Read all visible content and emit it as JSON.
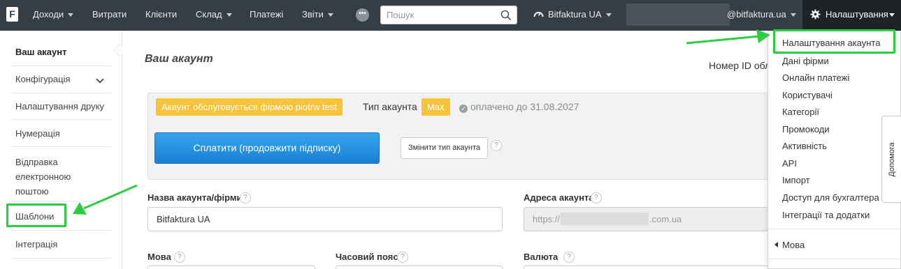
{
  "topbar": {
    "logo": "F",
    "nav": [
      {
        "label": "Доходи",
        "has_caret": true
      },
      {
        "label": "Витрати",
        "has_caret": false
      },
      {
        "label": "Клієнти",
        "has_caret": false
      },
      {
        "label": "Склад",
        "has_caret": true
      },
      {
        "label": "Платежі",
        "has_caret": false
      },
      {
        "label": "Звіти",
        "has_caret": true
      }
    ],
    "more_label": "•••",
    "search_placeholder": "Пошук",
    "company": "Bitfaktura UA",
    "email_suffix": "@bitfaktura.ua",
    "settings_label": "Налаштування"
  },
  "sidebar": {
    "items": [
      {
        "label": "Ваш акаунт",
        "active": true
      },
      {
        "label": "Конфігурація",
        "has_chevron": true
      },
      {
        "label": "Налаштування друку"
      },
      {
        "label": "Нумерація"
      },
      {
        "label": "Відправка електронною поштою"
      },
      {
        "label": "Шаблони"
      },
      {
        "label": "Інтеграція"
      }
    ]
  },
  "main": {
    "title": "Ваш акаунт",
    "id_label": "Номер ID облікового запису",
    "status": {
      "served_by": "Акаунт обслуговується фірмою piotrw test",
      "type_label": "Тип акаунта",
      "type_value": "Max",
      "paid_until": "оплачено до 31.08.2027"
    },
    "pay_button": "Сплатити (продовжити підписку)",
    "change_type_button": "Змінити тип акаунта",
    "help_q": "?",
    "fields": {
      "name_label": "Назва акаунта/фірми",
      "name_value": "Bitfaktura UA",
      "address_label": "Адреса акаунта",
      "address_prefix": "https://",
      "address_suffix": ".com.ua",
      "language_label": "Мова",
      "timezone_label": "Часовий пояс",
      "currency_label": "Валюта"
    }
  },
  "dropdown": {
    "items": [
      "Налаштування акаунта",
      "Дані фірми",
      "Онлайн платежі",
      "Користувачі",
      "Категорії",
      "Промокоди",
      "Активність",
      "API",
      "Імпорт",
      "Доступ для бухгалтера",
      "Інтеграції та додатки"
    ],
    "language": "Мова"
  },
  "help_tab": "Допомога",
  "colors": {
    "topbar": "#353d45",
    "settings_active": "#1e2328",
    "badge": "#f7c33b",
    "pay_button": "#1a7fd4",
    "annotation": "#2ecc40"
  }
}
